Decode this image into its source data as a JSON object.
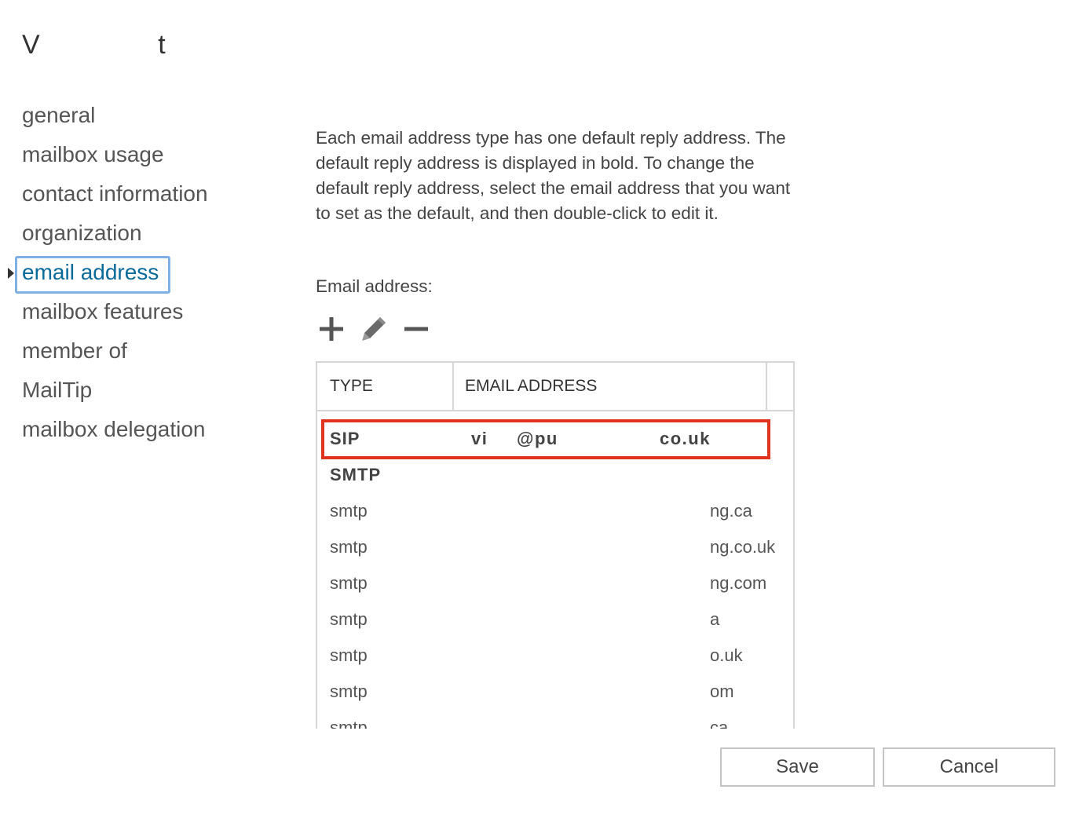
{
  "window": {
    "title_left": "V",
    "title_right": "t"
  },
  "sidebar": {
    "items": [
      {
        "label": "general",
        "selected": false
      },
      {
        "label": "mailbox usage",
        "selected": false
      },
      {
        "label": "contact information",
        "selected": false
      },
      {
        "label": "organization",
        "selected": false
      },
      {
        "label": "email address",
        "selected": true
      },
      {
        "label": "mailbox features",
        "selected": false
      },
      {
        "label": "member of",
        "selected": false
      },
      {
        "label": "MailTip",
        "selected": false
      },
      {
        "label": "mailbox delegation",
        "selected": false
      }
    ]
  },
  "main": {
    "description": "Each email address type has one default reply address. The default reply address is displayed in bold. To change the default reply address, select the email address that you want to set as the default, and then double-click to edit it.",
    "email_label": "Email address:",
    "toolbar": {
      "add_icon": "plus-icon",
      "edit_icon": "pencil-icon",
      "remove_icon": "minus-icon"
    },
    "table": {
      "columns": [
        "TYPE",
        "EMAIL ADDRESS"
      ],
      "sip_row": {
        "type": "SIP",
        "address_part1": "vi",
        "address_part2": "@pu",
        "address_part3": "co.uk"
      },
      "rows": [
        {
          "type": "SMTP",
          "address": ""
        },
        {
          "type": "smtp",
          "address": "ng.ca"
        },
        {
          "type": "smtp",
          "address": "ng.co.uk"
        },
        {
          "type": "smtp",
          "address": "ng.com"
        },
        {
          "type": "smtp",
          "address": "a"
        },
        {
          "type": "smtp",
          "address": "o.uk"
        },
        {
          "type": "smtp",
          "address": "om"
        },
        {
          "type": "smtp",
          "address": "ca"
        }
      ]
    }
  },
  "buttons": {
    "save": "Save",
    "cancel": "Cancel"
  },
  "colors": {
    "selected_text": "#0a6a9a",
    "selection_border": "#7fb0e6",
    "highlight_border": "#e0341f"
  }
}
